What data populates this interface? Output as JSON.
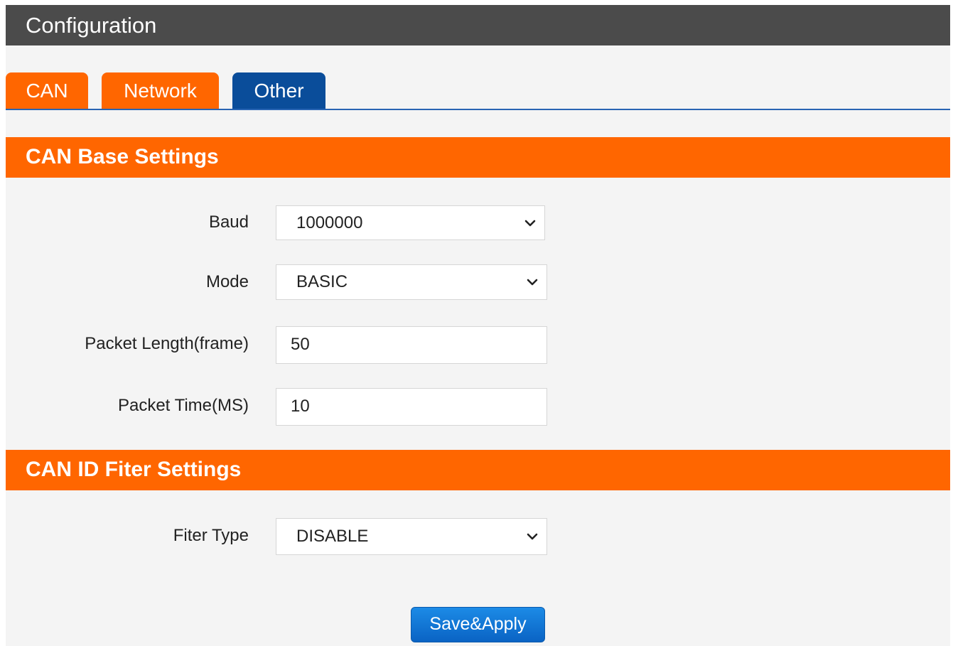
{
  "header": {
    "title": "Configuration"
  },
  "tabs": [
    {
      "label": "CAN",
      "color": "#ff6600"
    },
    {
      "label": "Network",
      "color": "#ff6600"
    },
    {
      "label": "Other",
      "color": "#0a4d9a"
    }
  ],
  "sections": {
    "base": {
      "title": "CAN Base Settings",
      "baud": {
        "label": "Baud",
        "value": "1000000"
      },
      "mode": {
        "label": "Mode",
        "value": "BASIC"
      },
      "packet_length": {
        "label": "Packet Length(frame)",
        "value": "50"
      },
      "packet_time": {
        "label": "Packet Time(MS)",
        "value": "10"
      }
    },
    "filter": {
      "title": "CAN ID Fiter Settings",
      "filter_type": {
        "label": "Fiter Type",
        "value": "DISABLE"
      }
    }
  },
  "actions": {
    "save_label": "Save&Apply"
  },
  "colors": {
    "header_bg": "#4b4b4b",
    "accent_orange": "#ff6600",
    "active_blue": "#0a4d9a",
    "button_blue": "#0a63c4"
  },
  "icons": {
    "dropdown": "chevron-down-icon"
  }
}
